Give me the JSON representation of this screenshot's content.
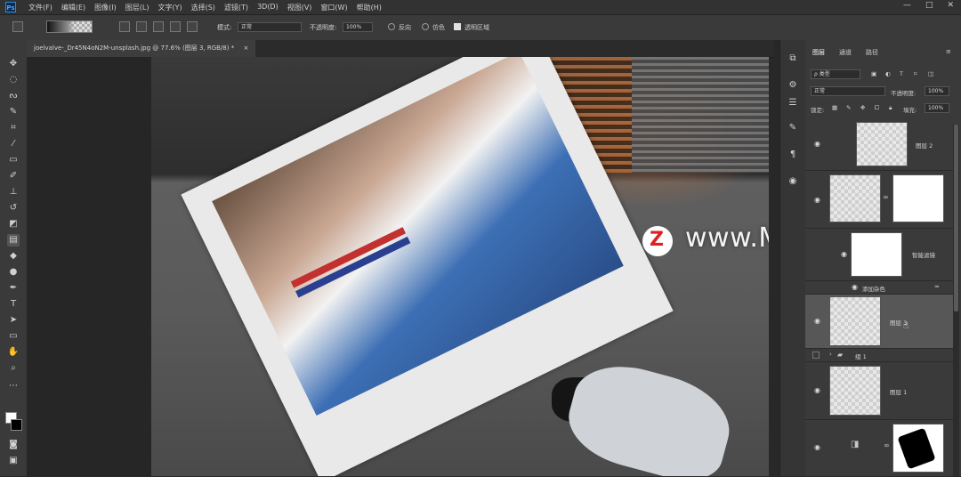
{
  "menubar": {
    "app_icon": "Ps",
    "items": [
      "文件(F)",
      "编辑(E)",
      "图像(I)",
      "图层(L)",
      "文字(Y)",
      "选择(S)",
      "滤镜(T)",
      "3D(D)",
      "视图(V)",
      "窗口(W)",
      "帮助(H)"
    ],
    "window_controls": [
      "—",
      "□",
      "✕"
    ]
  },
  "options": {
    "mode_label": "模式:",
    "mode_value": "正常",
    "opacity_label": "不透明度:",
    "opacity_value": "100%",
    "reverse_label": "反向",
    "dither_label": "仿色",
    "transparency_label": "透明区域"
  },
  "document": {
    "tab_title": "joelvalve-_Dr45N4oN2M-unsplash.jpg @ 77.6% (图层 3, RGB/8) *",
    "tab_close": "×"
  },
  "layers_panel": {
    "tabs": [
      "图层",
      "通道",
      "路径"
    ],
    "filter_kind": "ρ 类型",
    "blend_mode": "正常",
    "opacity_label": "不透明度:",
    "opacity_value": "100%",
    "lock_label": "锁定:",
    "fill_label": "填充:",
    "fill_value": "100%",
    "layer_names": {
      "layer2": "图层 2",
      "smart_filter": "智能滤镜",
      "add_noise": "添加杂色",
      "layer3": "图层 3",
      "group1": "组 1",
      "layer1": "图层 1"
    }
  },
  "watermark": {
    "logo": "Z",
    "text": "www.MacZ.com"
  },
  "colors": {
    "accent": "#2d8ce0",
    "panel_bg": "#3a3a3a",
    "canvas_bg": "#262626",
    "watermark_red": "#e02020"
  }
}
